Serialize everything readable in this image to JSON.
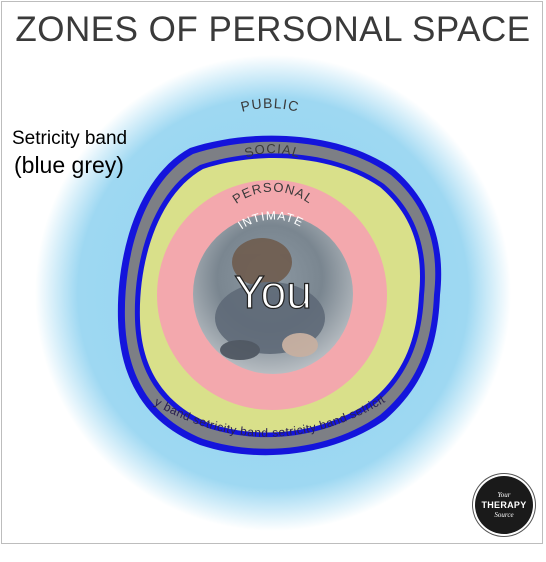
{
  "title": "ZONES OF PERSONAL SPACE",
  "annotation": {
    "line1": "Setricity band",
    "line2": "(blue grey)"
  },
  "zones": {
    "public": "PUBLIC",
    "social": "SOCIAL",
    "personal": "PERSONAL",
    "intimate": "INTIMATE",
    "center": "You"
  },
  "band_text": "setricity band setricity band setricity band setricity band",
  "logo": {
    "line1": "Your",
    "line2": "THERAPY",
    "line3": "Source"
  },
  "colors": {
    "public": "#9ed8f2",
    "social": "#d9e08a",
    "personal": "#f3a8ad",
    "intimate": "#9aa4ad",
    "band": "#7d7f85",
    "band_outline": "#1010d8"
  }
}
